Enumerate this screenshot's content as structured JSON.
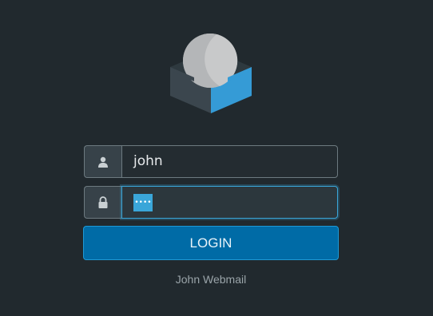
{
  "login": {
    "username_value": "john",
    "password_mask": "••••",
    "button_label": "LOGIN"
  },
  "footer": {
    "product_name": "John Webmail"
  },
  "icons": {
    "logo": "roundcube-logo",
    "username": "user-icon",
    "password": "lock-icon"
  },
  "colors": {
    "background": "#21292e",
    "accent": "#3aa6d9",
    "button": "#006ba6"
  }
}
